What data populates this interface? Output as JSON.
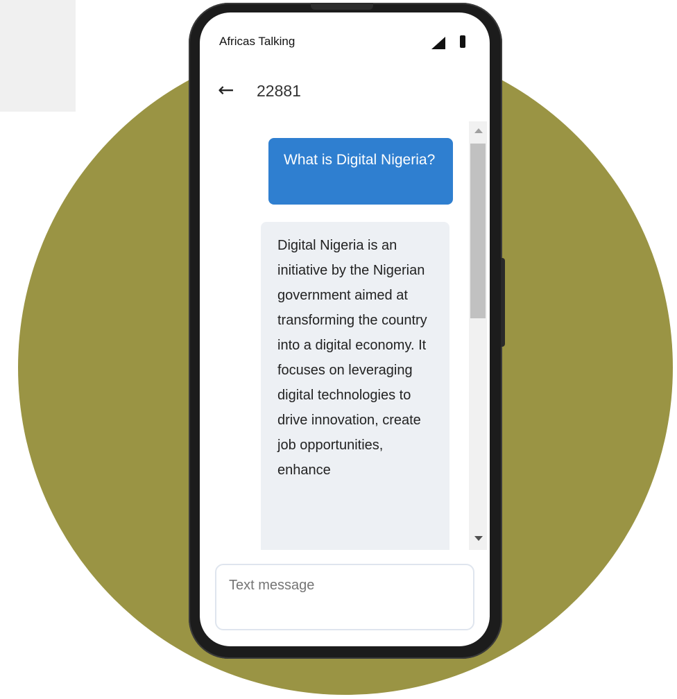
{
  "status_bar": {
    "carrier": "Africas Talking",
    "signal_icon": "signal-icon",
    "battery_icon": "battery-icon"
  },
  "header": {
    "back_icon": "arrow-left-icon",
    "back_glyph": "←",
    "contact": "22881"
  },
  "messages": [
    {
      "direction": "outgoing",
      "text": "What is Digital Nigeria?"
    },
    {
      "direction": "incoming",
      "text": "Digital Nigeria is an initiative by the Nigerian government aimed at transforming the country into a digital economy. It focuses on leveraging digital technologies to drive innovation, create job opportunities, enhance"
    }
  ],
  "composer": {
    "placeholder": "Text message"
  },
  "colors": {
    "background_circle": "#9a9444",
    "outgoing_bubble": "#2f7fd0",
    "incoming_bubble": "#edf0f4"
  }
}
